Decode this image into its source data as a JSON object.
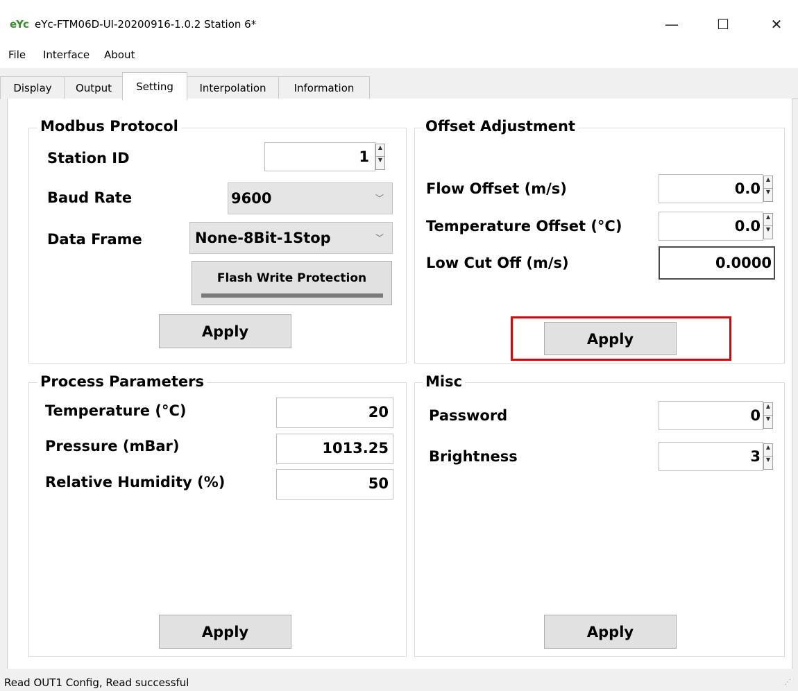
{
  "window": {
    "logo_text": "eYc",
    "title": "eYc-FTM06D-UI-20200916-1.0.2  Station 6*",
    "minimize": "—",
    "maximize": "☐",
    "close": "✕"
  },
  "menu": [
    "File",
    "Interface",
    "About"
  ],
  "tabs": [
    "Display",
    "Output",
    "Setting",
    "Interpolation",
    "Information"
  ],
  "active_tab": "Setting",
  "modbus": {
    "title": "Modbus Protocol",
    "station_id_label": "Station ID",
    "station_id_value": "1",
    "baud_rate_label": "Baud Rate",
    "baud_rate_value": "9600",
    "data_frame_label": "Data Frame",
    "data_frame_value": "None-8Bit-1Stop",
    "flash_button": "Flash Write Protection",
    "apply": "Apply"
  },
  "offset": {
    "title": "Offset Adjustment",
    "flow_label": "Flow Offset (m/s)",
    "flow_value": "0.0",
    "temp_label": "Temperature Offset (°C)",
    "temp_value": "0.0",
    "lowcut_label": "Low Cut Off (m/s)",
    "lowcut_value": "0.0000",
    "apply": "Apply"
  },
  "process": {
    "title": "Process Parameters",
    "temp_label": "Temperature (°C)",
    "temp_value": "20",
    "pressure_label": "Pressure (mBar)",
    "pressure_value": "1013.25",
    "humidity_label": "Relative Humidity (%)",
    "humidity_value": "50",
    "apply": "Apply"
  },
  "misc": {
    "title": "Misc",
    "password_label": "Password",
    "password_value": "0",
    "brightness_label": "Brightness",
    "brightness_value": "3",
    "apply": "Apply"
  },
  "status": "Read OUT1 Config,   Read successful",
  "colors": {
    "highlight": "#e00000",
    "logo": "#3a8f2f"
  }
}
